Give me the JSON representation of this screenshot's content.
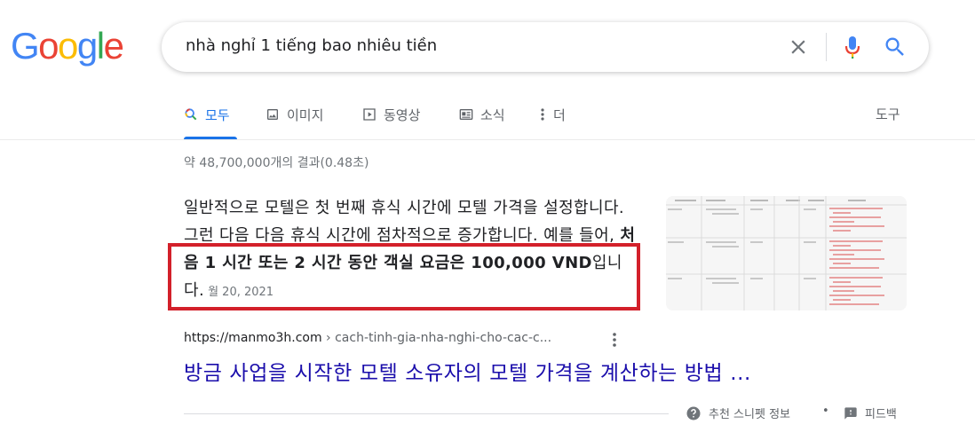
{
  "logo": {
    "letters": [
      "G",
      "o",
      "o",
      "g",
      "l",
      "e"
    ],
    "colors": [
      "#4285f4",
      "#ea4335",
      "#fbbc05",
      "#4285f4",
      "#34a853",
      "#ea4335"
    ]
  },
  "search": {
    "query": "nhà nghỉ 1 tiếng bao nhiêu tiền"
  },
  "icons": {
    "clear": "close-icon",
    "mic": "microphone-icon",
    "search": "search-icon"
  },
  "tabs": [
    {
      "label": "모두",
      "icon": "search-icon",
      "active": true
    },
    {
      "label": "이미지",
      "icon": "image-icon",
      "active": false
    },
    {
      "label": "동영상",
      "icon": "video-icon",
      "active": false
    },
    {
      "label": "소식",
      "icon": "news-icon",
      "active": false
    },
    {
      "label": "더",
      "icon": "more-vert-icon",
      "active": false
    }
  ],
  "tools_label": "도구",
  "result_stats": "약 48,700,000개의 결과(0.48초)",
  "snippet": {
    "text_normal": "일반적으로 모텔은 첫 번째 휴식 시간에 모텔 가격을 설정합니다. 그런 다음 다음 휴식 시간에 점차적으로 증가합니다. 예를 들어, ",
    "text_bold": "처음 1 시간 또는 2 시간 동안 객실 요금은 100,000 VND",
    "text_end": "입니다.",
    "date": "월 20, 2021"
  },
  "result": {
    "domain": "https://manmo3h.com",
    "path": " › cach-tinh-gia-nha-nghi-cho-cac-c...",
    "title": "방금 사업을 시작한 모텔 소유자의 모텔 가격을 계산하는 방법 ..."
  },
  "footer": {
    "about_label": "추천 스니펫 정보",
    "separator": "•",
    "feedback_label": "피드백"
  },
  "accent_colors": {
    "active_tab": "#1a73e8",
    "link": "#1a0dab",
    "highlight": "#d3202a"
  }
}
